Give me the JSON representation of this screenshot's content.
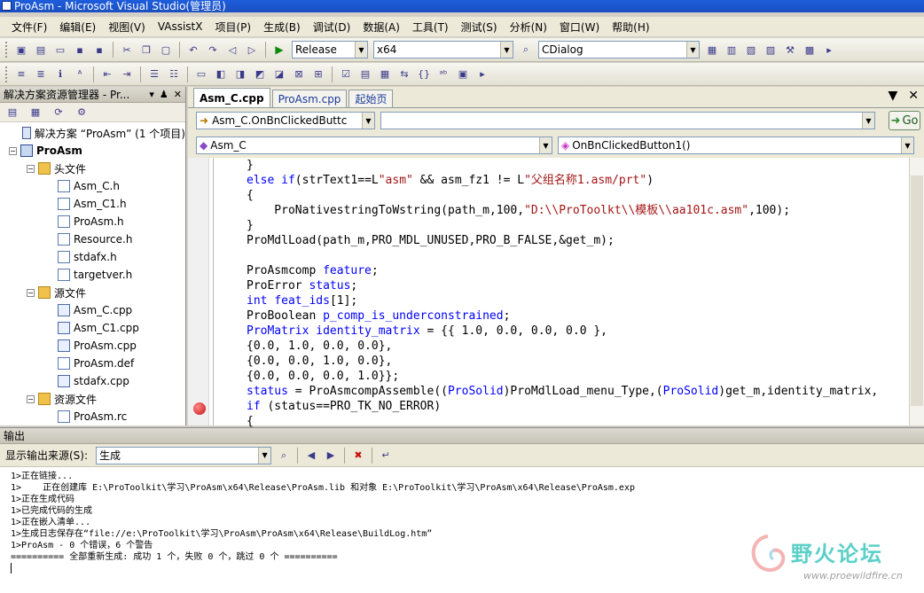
{
  "window": {
    "title": "ProAsm - Microsoft Visual Studio(管理员)"
  },
  "menubar": {
    "items": [
      "文件(F)",
      "编辑(E)",
      "视图(V)",
      "VAssistX",
      "项目(P)",
      "生成(B)",
      "调试(D)",
      "数据(A)",
      "工具(T)",
      "测试(S)",
      "分析(N)",
      "窗口(W)",
      "帮助(H)"
    ]
  },
  "toolbar": {
    "configuration": "Release",
    "platform": "x64",
    "find_combo": "CDialog"
  },
  "explorer": {
    "title": "解决方案资源管理器 - Pr...",
    "pin": "♟",
    "close": "✕",
    "tree": [
      {
        "label": "解决方案 “ProAsm” (1 个项目)",
        "depth": 0,
        "kind": "sol"
      },
      {
        "label": "ProAsm",
        "depth": 1,
        "kind": "proj",
        "expander": "−"
      },
      {
        "label": "头文件",
        "depth": 2,
        "kind": "folder",
        "expander": "−"
      },
      {
        "label": "Asm_C.h",
        "depth": 3,
        "kind": "file"
      },
      {
        "label": "Asm_C1.h",
        "depth": 3,
        "kind": "file"
      },
      {
        "label": "ProAsm.h",
        "depth": 3,
        "kind": "file"
      },
      {
        "label": "Resource.h",
        "depth": 3,
        "kind": "file"
      },
      {
        "label": "stdafx.h",
        "depth": 3,
        "kind": "file"
      },
      {
        "label": "targetver.h",
        "depth": 3,
        "kind": "file"
      },
      {
        "label": "源文件",
        "depth": 2,
        "kind": "folder",
        "expander": "−"
      },
      {
        "label": "Asm_C.cpp",
        "depth": 3,
        "kind": "cpp"
      },
      {
        "label": "Asm_C1.cpp",
        "depth": 3,
        "kind": "cpp"
      },
      {
        "label": "ProAsm.cpp",
        "depth": 3,
        "kind": "cpp"
      },
      {
        "label": "ProAsm.def",
        "depth": 3,
        "kind": "file"
      },
      {
        "label": "stdafx.cpp",
        "depth": 3,
        "kind": "cpp"
      },
      {
        "label": "资源文件",
        "depth": 2,
        "kind": "folder",
        "expander": "−"
      },
      {
        "label": "ProAsm.rc",
        "depth": 3,
        "kind": "file"
      }
    ]
  },
  "editor": {
    "tabs": [
      "Asm_C.cpp",
      "ProAsm.cpp",
      "起始页"
    ],
    "active_tab": 0,
    "tab_dropdown": "▼",
    "tab_close": "✕",
    "nav_member": "Asm_C.OnBnClickedButtc",
    "nav_search": "",
    "go_label": "Go",
    "scope_class": "Asm_C",
    "scope_method": "OnBnClickedButton1()"
  },
  "output": {
    "title": "输出",
    "source_label": "显示输出来源(S):",
    "source_value": "生成",
    "lines": [
      "1>正在链接...",
      "1>    正在创建库 E:\\ProToolkit\\学习\\ProAsm\\x64\\Release\\ProAsm.lib 和对象 E:\\ProToolkit\\学习\\ProAsm\\x64\\Release\\ProAsm.exp",
      "1>正在生成代码",
      "1>已完成代码的生成",
      "1>正在嵌入清单...",
      "1>生成日志保存在“file://e:\\ProToolkit\\学习\\ProAsm\\ProAsm\\x64\\Release\\BuildLog.htm”",
      "1>ProAsm - 0 个错误，6 个警告",
      "========== 全部重新生成: 成功 1 个，失败 0 个，跳过 0 个 =========="
    ]
  },
  "watermark": {
    "title": "野火论坛",
    "url": "www.proewildfire.cn"
  },
  "colors": {
    "keyword": "#0000ff",
    "string": "#a31515",
    "title_bar": "#1d5ddc",
    "breakpoint": "#c81010"
  }
}
